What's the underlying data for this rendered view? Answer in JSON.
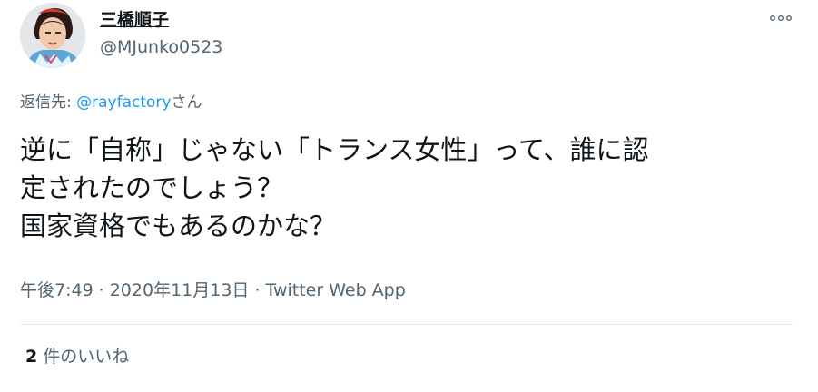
{
  "user": {
    "display_name": "三橋順子",
    "handle": "@MJunko0523"
  },
  "reply": {
    "prefix": "返信先: ",
    "target": "@rayfactory",
    "suffix": "さん"
  },
  "tweet": {
    "text": "逆に「自称」じゃない「トランス女性」って、誰に認\n定されたのでしょう？\n国家資格でもあるのかな？"
  },
  "meta": {
    "time": "午後7:49",
    "separator": "·",
    "date": "2020年11月13日",
    "source": "Twitter Web App"
  },
  "likes": {
    "count": "2",
    "label": "件のいいね"
  },
  "icons": {
    "more": "more-horizontal-icon"
  },
  "colors": {
    "link": "#1d9bf0",
    "secondary_text": "#536471",
    "primary_text": "#0f1419",
    "divider": "#e6e9eb"
  }
}
